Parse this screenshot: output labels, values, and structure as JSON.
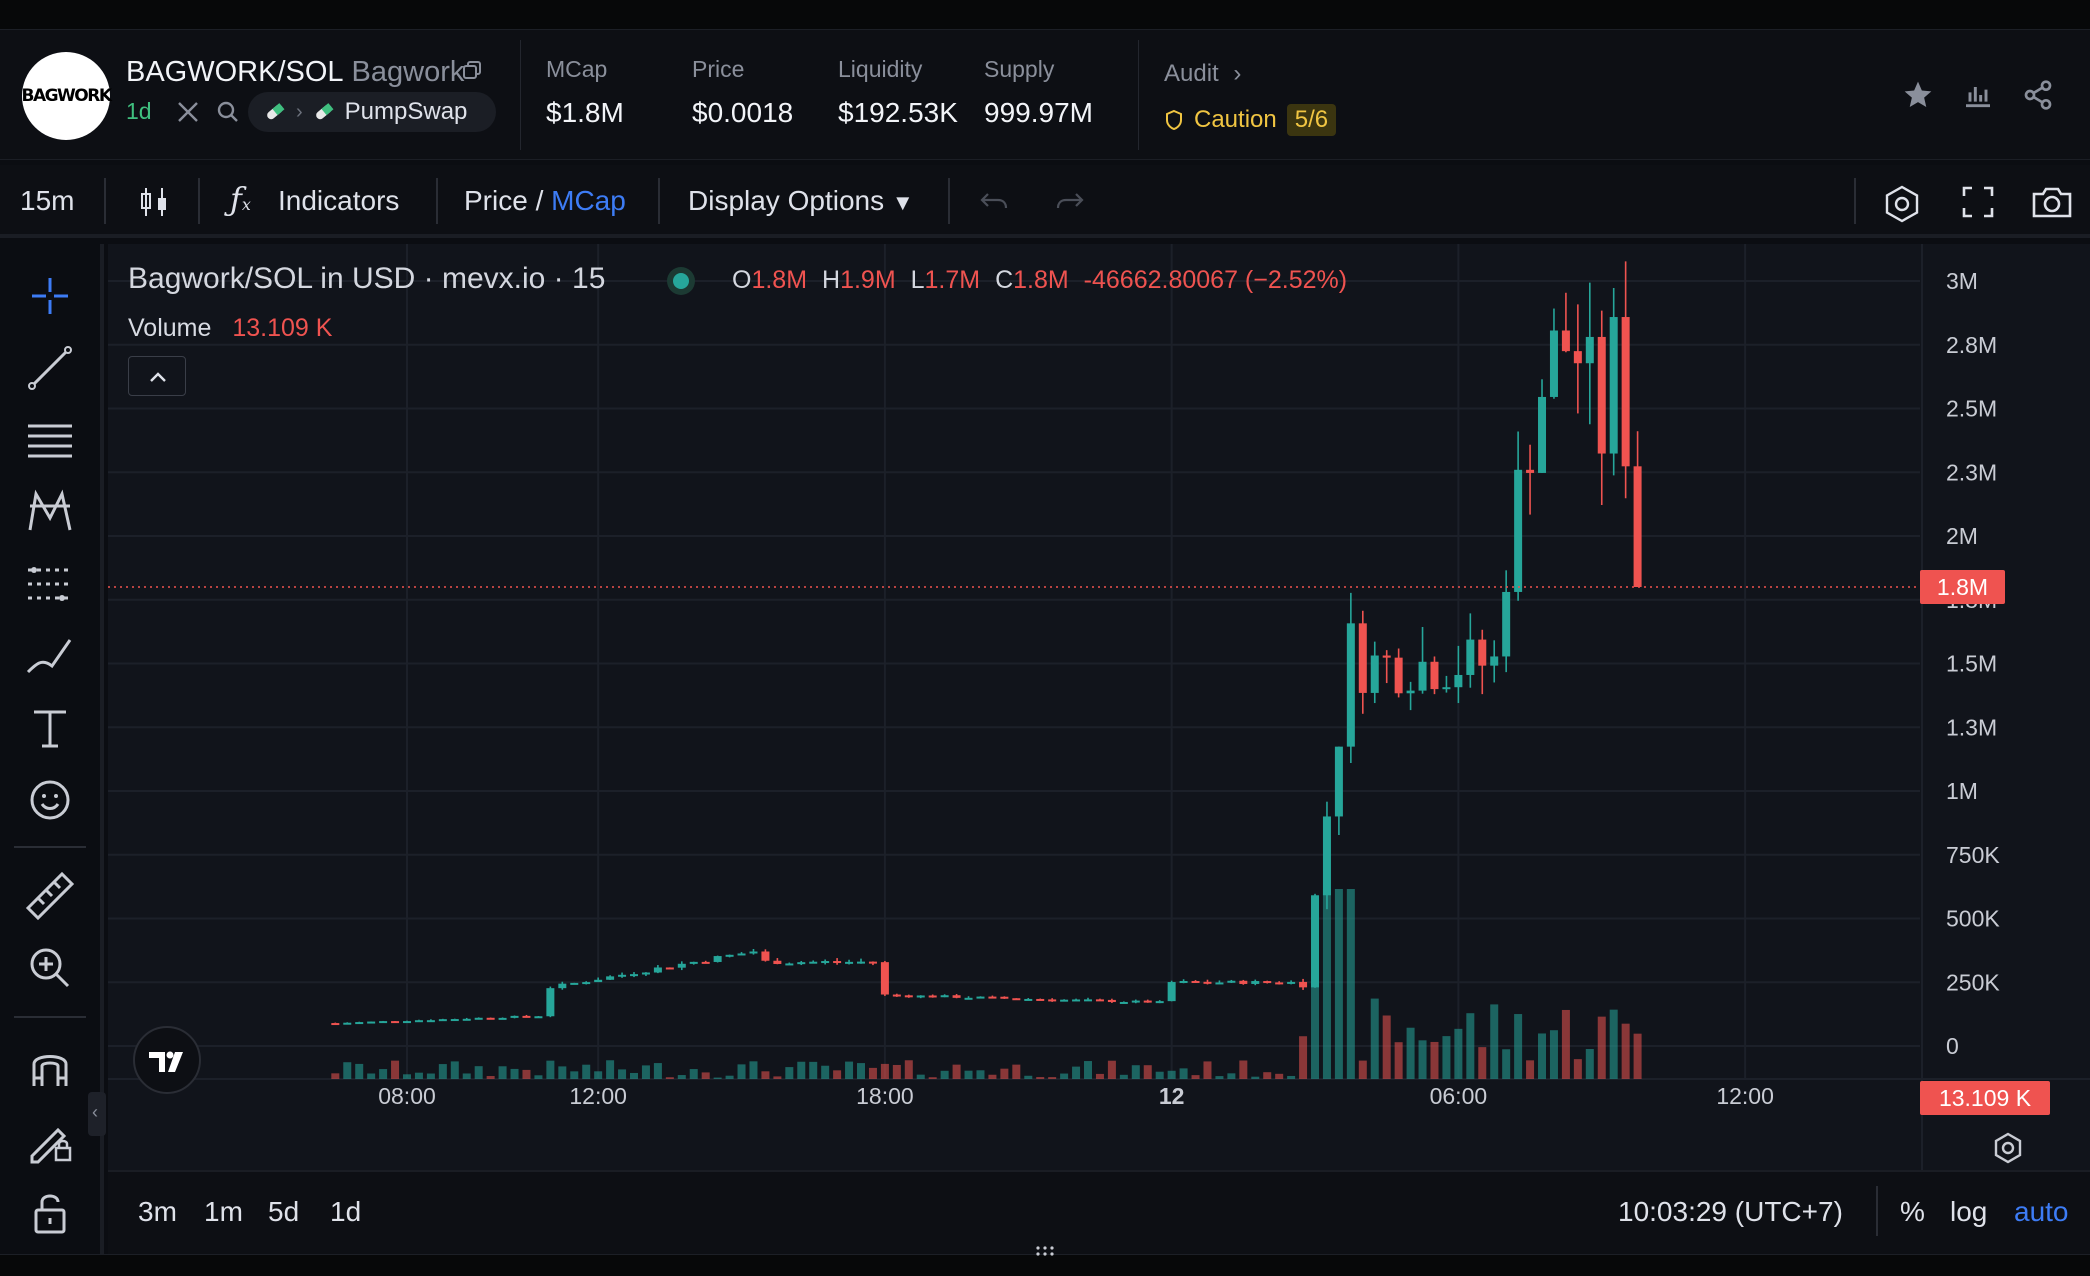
{
  "token": {
    "logo_text": "BAGWORK",
    "symbol": "BAGWORK/SOL",
    "name": "Bagwork",
    "age": "1d",
    "dex": "PumpSwap"
  },
  "stats": [
    {
      "label": "MCap",
      "value": "$1.8M"
    },
    {
      "label": "Price",
      "value": "$0.0018"
    },
    {
      "label": "Liquidity",
      "value": "$192.53K"
    },
    {
      "label": "Supply",
      "value": "999.97M"
    }
  ],
  "audit": {
    "label": "Audit",
    "status": "Caution",
    "score": "5/6"
  },
  "toolbar": {
    "interval": "15m",
    "indicators": "Indicators",
    "price_label": "Price",
    "slash": " / ",
    "mcap_label": "MCap",
    "display_options": "Display Options"
  },
  "legend": {
    "title": "Bagwork/SOL in USD · mevx.io · 15",
    "o_key": "O",
    "o_val": "1.8M",
    "h_key": "H",
    "h_val": "1.9M",
    "l_key": "L",
    "l_val": "1.7M",
    "c_key": "C",
    "c_val": "1.8M",
    "change": "-46662.80067 (−2.52%)",
    "volume_label": "Volume",
    "volume_val": "13.109 K"
  },
  "price_tag": "1.8M",
  "volume_tag": "13.109 K",
  "y_ticks": [
    "3M",
    "2.8M",
    "2.5M",
    "2.3M",
    "2M",
    "1.8M",
    "1.5M",
    "1.3M",
    "1M",
    "750K",
    "500K",
    "250K",
    "0"
  ],
  "x_ticks": [
    "08:00",
    "12:00",
    "18:00",
    "12",
    "06:00",
    "12:00"
  ],
  "bottom": {
    "ranges": [
      "3m",
      "1m",
      "5d",
      "1d"
    ],
    "clock": "10:03:29 (UTC+7)",
    "pct": "%",
    "log": "log",
    "auto": "auto"
  },
  "colors": {
    "up": "#26a69a",
    "down": "#ef5350",
    "accent": "#3d7cf5",
    "caution": "#f0c542"
  },
  "chart_data": {
    "type": "candlestick",
    "interval": "15m",
    "yunit": "USD market cap",
    "ylim": [
      0,
      3000000
    ],
    "x_ticks": [
      "08:00",
      "12:00",
      "18:00",
      "12",
      "06:00",
      "12:00"
    ],
    "last_close": 1800000,
    "segments": [
      {
        "from": "06:30",
        "to": "11:00",
        "level": 90000,
        "trend": "rising to 120000"
      },
      {
        "from": "11:00",
        "to": "15:30",
        "level": 230000,
        "trend": "rising to 380000 peak"
      },
      {
        "from": "15:30",
        "to": "18:00",
        "level": 330000,
        "trend": "flat"
      },
      {
        "from": "18:00",
        "to": "00:00",
        "level": 200000,
        "trend": "declining to 170000"
      },
      {
        "from": "00:00",
        "to": "02:45",
        "level": 250000,
        "trend": "slight rise"
      },
      {
        "from": "02:45",
        "to": "04:00",
        "level": 1900000,
        "trend": "pump from 250000"
      },
      {
        "from": "04:00",
        "to": "07:00",
        "level": 1500000,
        "trend": "volatile 1.1M-2.0M"
      },
      {
        "from": "07:00",
        "to": "09:15",
        "level": 2700000,
        "trend": "peak near 2.8M"
      },
      {
        "from": "09:15",
        "to": "10:00",
        "level": 1800000,
        "trend": "drop to close"
      }
    ]
  }
}
